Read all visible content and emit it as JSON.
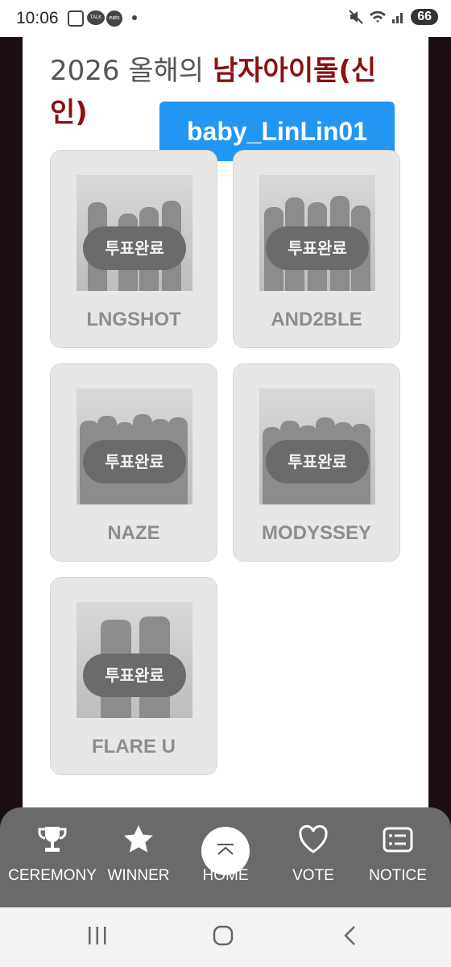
{
  "status_bar": {
    "time": "10:06",
    "talk_label": "TALK",
    "eats_label": "eats",
    "battery": "66"
  },
  "header": {
    "title_plain": "2026 올해의 ",
    "title_highlight": "남자아이돌(신인)"
  },
  "user_chip": {
    "username": "baby_LinLin01"
  },
  "vote_badge": "투표완료",
  "idols": [
    {
      "name": "LNGSHOT",
      "status": "투표완료"
    },
    {
      "name": "AND2BLE",
      "status": "투표완료"
    },
    {
      "name": "NAZE",
      "status": "투표완료"
    },
    {
      "name": "MODYSSEY",
      "status": "투표완료"
    },
    {
      "name": "FLARE U",
      "status": "투표완료"
    }
  ],
  "bottom_nav": {
    "items": [
      {
        "label": "CEREMONY",
        "icon": "trophy-icon"
      },
      {
        "label": "WINNER",
        "icon": "star-icon"
      },
      {
        "label": "HOME",
        "icon": "home-icon"
      },
      {
        "label": "VOTE",
        "icon": "heart-icon"
      },
      {
        "label": "NOTICE",
        "icon": "list-icon"
      }
    ]
  },
  "colors": {
    "accent": "#8b1111",
    "chip": "#2196f3",
    "nav_bg": "#6a6a6a"
  }
}
